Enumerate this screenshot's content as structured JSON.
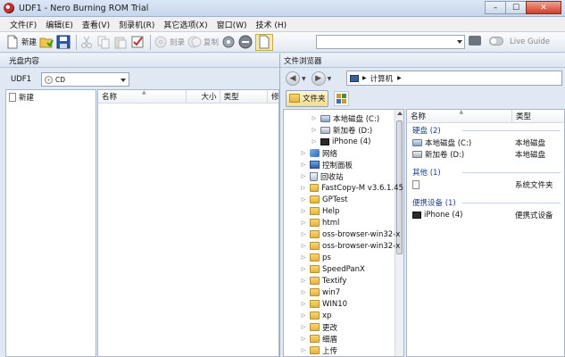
{
  "window": {
    "title": "UDF1 - Nero Burning ROM Trial",
    "min": "–",
    "max": "☐",
    "close": "✕"
  },
  "menu": [
    "文件(F)",
    "编辑(E)",
    "查看(V)",
    "刻录机(R)",
    "其它选项(X)",
    "窗口(W)",
    "技术 (H)"
  ],
  "toolbar": {
    "new": "新建",
    "burn": "刻录",
    "copy": "复制",
    "live_guide": "Live Guide"
  },
  "left_panel": {
    "header": "光盘内容",
    "udf_label": "UDF1",
    "disc_type": "CD",
    "tree_new": "新建",
    "columns": {
      "name": "名称",
      "size": "大小",
      "type": "类型",
      "modified": "修"
    }
  },
  "right_panel": {
    "header": "文件浏览器",
    "address": "计算机",
    "folder_btn": "文件夹",
    "tree": [
      {
        "label": "本地磁盘 (C:)",
        "icon": "drive-win",
        "indent": 2
      },
      {
        "label": "新加卷 (D:)",
        "icon": "drive",
        "indent": 2
      },
      {
        "label": "iPhone (4)",
        "icon": "phone",
        "indent": 2
      },
      {
        "label": "网络",
        "icon": "net",
        "indent": 1
      },
      {
        "label": "控制面板",
        "icon": "ctrl",
        "indent": 1
      },
      {
        "label": "回收站",
        "icon": "bin",
        "indent": 1
      },
      {
        "label": "FastCopy-M v3.6.1.45",
        "icon": "folder",
        "indent": 1
      },
      {
        "label": "GPTest",
        "icon": "folder",
        "indent": 1
      },
      {
        "label": "Help",
        "icon": "folder",
        "indent": 1
      },
      {
        "label": "html",
        "icon": "folder",
        "indent": 1
      },
      {
        "label": "oss-browser-win32-x",
        "icon": "folder",
        "indent": 1
      },
      {
        "label": "oss-browser-win32-x",
        "icon": "folder",
        "indent": 1
      },
      {
        "label": "ps",
        "icon": "folder",
        "indent": 1
      },
      {
        "label": "SpeedPanX",
        "icon": "folder",
        "indent": 1
      },
      {
        "label": "Textify",
        "icon": "folder",
        "indent": 1
      },
      {
        "label": "win7",
        "icon": "folder",
        "indent": 1
      },
      {
        "label": "WIN10",
        "icon": "folder",
        "indent": 1
      },
      {
        "label": "xp",
        "icon": "folder",
        "indent": 1
      },
      {
        "label": "更改",
        "icon": "folder",
        "indent": 1
      },
      {
        "label": "细盾",
        "icon": "folder",
        "indent": 1
      },
      {
        "label": "上传",
        "icon": "folder",
        "indent": 1
      }
    ],
    "list_columns": {
      "name": "名称",
      "type": "类型"
    },
    "groups": [
      {
        "title": "硬盘 (2)",
        "items": [
          {
            "name": "本地磁盘 (C:)",
            "type": "本地磁盘",
            "icon": "drive-win"
          },
          {
            "name": "新加卷 (D:)",
            "type": "本地磁盘",
            "icon": "drive"
          }
        ]
      },
      {
        "title": "其他 (1)",
        "items": [
          {
            "name": "",
            "type": "系统文件夹",
            "icon": "doc"
          }
        ]
      },
      {
        "title": "便携设备 (1)",
        "items": [
          {
            "name": "iPhone (4)",
            "type": "便携式设备",
            "icon": "phone"
          }
        ]
      }
    ]
  }
}
